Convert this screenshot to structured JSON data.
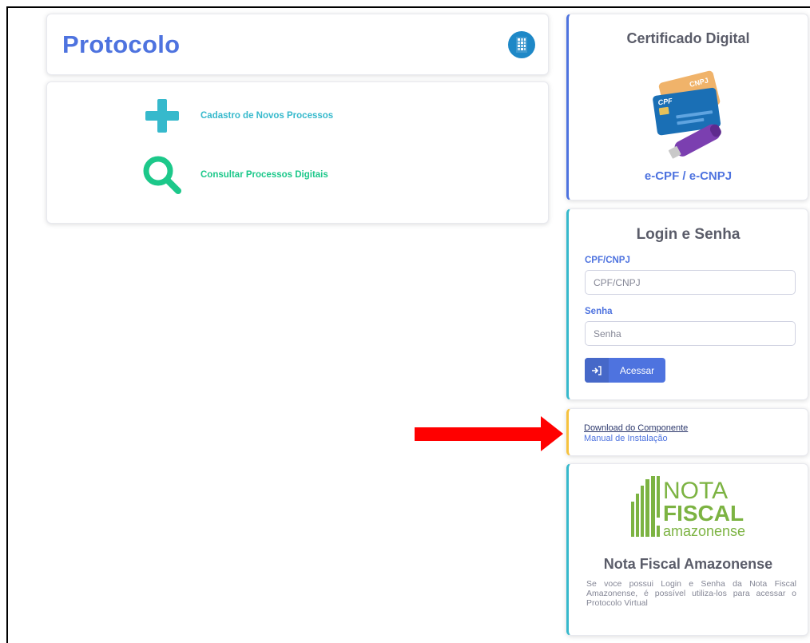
{
  "header": {
    "title": "Protocolo",
    "brand_icon": "building-icon"
  },
  "menu": {
    "items": [
      {
        "label": "Cadastro de Novos Processos",
        "icon": "plus-icon",
        "color": "#36b9cc"
      },
      {
        "label": "Consultar Processos Digitais",
        "icon": "search-icon",
        "color": "#1cc88a"
      }
    ]
  },
  "certificate": {
    "title": "Certificado Digital",
    "image_labels": {
      "card_back": "CNPJ",
      "card_front": "CPF"
    },
    "link": "e-CPF / e-CNPJ",
    "accent": "#4e73df"
  },
  "login": {
    "title": "Login e Senha",
    "cpf_label": "CPF/CNPJ",
    "cpf_placeholder": "CPF/CNPJ",
    "password_label": "Senha",
    "password_placeholder": "Senha",
    "submit_label": "Acessar",
    "submit_icon": "sign-in-icon",
    "accent": "#36b9cc"
  },
  "downloads": {
    "component_link": "Download do Componente",
    "manual_link": "Manual de Instalação",
    "accent": "#f6c23e"
  },
  "nota_fiscal": {
    "logo_line1": "NOTA",
    "logo_line2": "FISCAL",
    "logo_line3": "amazonense",
    "title": "Nota Fiscal Amazonense",
    "description": "Se voce possui Login e Senha da Nota Fiscal Amazonense, é possível utiliza-los para acessar o Protocolo Virtual",
    "logo_color": "#7cb342"
  },
  "annotation": {
    "arrow_color": "#ff0000",
    "arrow_icon": "arrow-right-icon"
  }
}
